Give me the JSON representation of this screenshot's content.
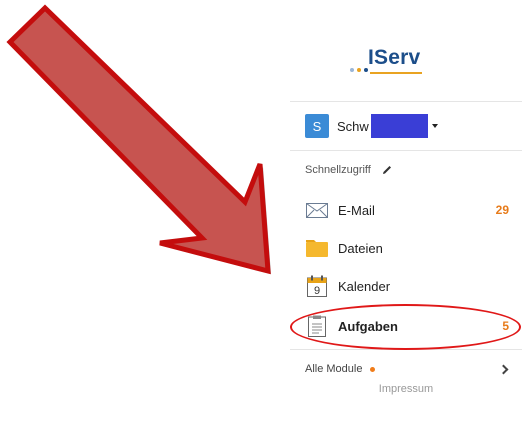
{
  "logo": {
    "text": "IServ"
  },
  "user": {
    "initial": "S",
    "name": "Schw"
  },
  "quick_access": {
    "label": "Schnellzugriff",
    "edit_icon": "pencil-icon"
  },
  "nav": [
    {
      "label": "E-Mail",
      "icon": "envelope-icon",
      "count": "29"
    },
    {
      "label": "Dateien",
      "icon": "folder-icon",
      "count": ""
    },
    {
      "label": "Kalender",
      "icon": "calendar-icon",
      "count": "",
      "calendar_day": "9"
    },
    {
      "label": "Aufgaben",
      "icon": "clipboard-icon",
      "count": "5",
      "active": true
    }
  ],
  "all_modules": {
    "label": "Alle Module"
  },
  "footer": {
    "impressum": "Impressum"
  },
  "colors": {
    "accent": "#e77b1a",
    "logo_blue": "#1c4e8a",
    "avatar": "#3b8bd6",
    "highlight": "#e01818",
    "arrow_fill": "#c75450",
    "arrow_stroke": "#c40d0d"
  }
}
